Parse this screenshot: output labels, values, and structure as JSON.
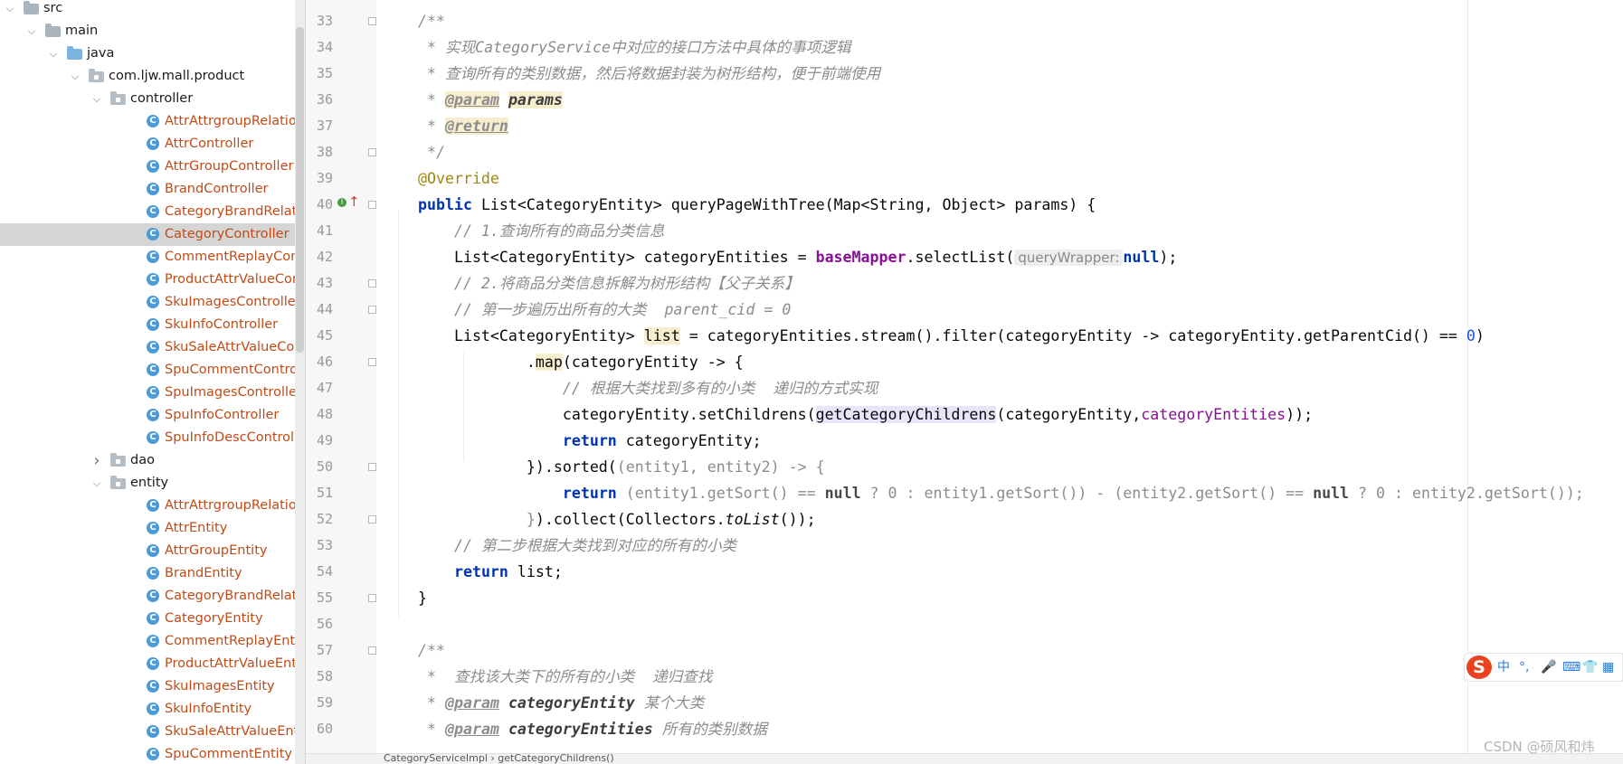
{
  "tree": {
    "nodes": [
      {
        "label": "src",
        "kind": "folder",
        "depth": 0,
        "expanded": true
      },
      {
        "label": "main",
        "kind": "folder",
        "depth": 1,
        "expanded": true
      },
      {
        "label": "java",
        "kind": "folder-blue",
        "depth": 2,
        "expanded": true
      },
      {
        "label": "com.ljw.mall.product",
        "kind": "package",
        "depth": 3,
        "expanded": true
      },
      {
        "label": "controller",
        "kind": "package",
        "depth": 4,
        "expanded": true
      },
      {
        "label": "AttrAttrgroupRelationCo",
        "kind": "class",
        "depth": 5
      },
      {
        "label": "AttrController",
        "kind": "class",
        "depth": 5
      },
      {
        "label": "AttrGroupController",
        "kind": "class",
        "depth": 5
      },
      {
        "label": "BrandController",
        "kind": "class",
        "depth": 5
      },
      {
        "label": "CategoryBrandRelationC",
        "kind": "class",
        "depth": 5
      },
      {
        "label": "CategoryController",
        "kind": "class",
        "depth": 5,
        "selected": true
      },
      {
        "label": "CommentReplayControl",
        "kind": "class",
        "depth": 5
      },
      {
        "label": "ProductAttrValueContro",
        "kind": "class",
        "depth": 5
      },
      {
        "label": "SkuImagesController",
        "kind": "class",
        "depth": 5
      },
      {
        "label": "SkuInfoController",
        "kind": "class",
        "depth": 5
      },
      {
        "label": "SkuSaleAttrValueContro",
        "kind": "class",
        "depth": 5
      },
      {
        "label": "SpuCommentController",
        "kind": "class",
        "depth": 5
      },
      {
        "label": "SpuImagesController",
        "kind": "class",
        "depth": 5
      },
      {
        "label": "SpuInfoController",
        "kind": "class",
        "depth": 5
      },
      {
        "label": "SpuInfoDescController",
        "kind": "class",
        "depth": 5
      },
      {
        "label": "dao",
        "kind": "package",
        "depth": 4,
        "expanded": false
      },
      {
        "label": "entity",
        "kind": "package",
        "depth": 4,
        "expanded": true
      },
      {
        "label": "AttrAttrgroupRelationEn",
        "kind": "class",
        "depth": 5
      },
      {
        "label": "AttrEntity",
        "kind": "class",
        "depth": 5
      },
      {
        "label": "AttrGroupEntity",
        "kind": "class",
        "depth": 5
      },
      {
        "label": "BrandEntity",
        "kind": "class",
        "depth": 5
      },
      {
        "label": "CategoryBrandRelationE",
        "kind": "class",
        "depth": 5
      },
      {
        "label": "CategoryEntity",
        "kind": "class",
        "depth": 5
      },
      {
        "label": "CommentReplayEntity",
        "kind": "class",
        "depth": 5
      },
      {
        "label": "ProductAttrValueEntity",
        "kind": "class",
        "depth": 5
      },
      {
        "label": "SkuImagesEntity",
        "kind": "class",
        "depth": 5
      },
      {
        "label": "SkuInfoEntity",
        "kind": "class",
        "depth": 5
      },
      {
        "label": "SkuSaleAttrValueEntity",
        "kind": "class",
        "depth": 5
      },
      {
        "label": "SpuCommentEntity",
        "kind": "class",
        "depth": 5
      }
    ]
  },
  "editor": {
    "line_numbers": [
      "33",
      "34",
      "35",
      "36",
      "37",
      "38",
      "39",
      "40",
      "41",
      "42",
      "43",
      "44",
      "45",
      "46",
      "47",
      "48",
      "49",
      "50",
      "51",
      "52",
      "53",
      "54",
      "55",
      "56",
      "57",
      "58",
      "59",
      "60"
    ],
    "code": {
      "l33": "/**",
      "l34": " * 实现CategoryService中对应的接口方法中具体的事项逻辑",
      "l35": " * 查询所有的类别数据，然后将数据封装为树形结构，便于前端使用",
      "l36_star": " * ",
      "l36_tag": "@param",
      "l36_name": "params",
      "l37_star": " * ",
      "l37_tag": "@return",
      "l38": " */",
      "l39": "@Override",
      "l40_kw": "public",
      "l40_rest": " List<CategoryEntity> queryPageWithTree(Map<String, Object> params) {",
      "l41": "    // 1.查询所有的商品分类信息",
      "l42_a": "    List<CategoryEntity> categoryEntities = ",
      "l42_field": "baseMapper",
      "l42_b": ".selectList(",
      "l42_hint": "queryWrapper:",
      "l42_null": "null",
      "l42_c": ");",
      "l43": "    // 2.将商品分类信息拆解为树形结构【父子关系】",
      "l44": "    // 第一步遍历出所有的大类  parent_cid = 0",
      "l45_a": "    List<CategoryEntity> ",
      "l45_var": "list",
      "l45_b": " = categoryEntities.stream().filter(categoryEntity -> categoryEntity.getParentCid() == ",
      "l45_num": "0",
      "l45_c": ")",
      "l46_a": "            .",
      "l46_map": "map",
      "l46_b": "(categoryEntity -> {",
      "l47": "                // 根据大类找到多有的小类  递归的方式实现",
      "l48_a": "                categoryEntity.setChildrens(",
      "l48_call": "getCategoryChildrens",
      "l48_b": "(categoryEntity,",
      "l48_field": "categoryEntities",
      "l48_c": "));",
      "l49_ret": "return",
      "l49_rest": " categoryEntity;",
      "l50_a": "            }).sorted(",
      "l50_b": "(entity1, entity2) -> {",
      "l51_ret": "return",
      "l51_a": " (entity1.getSort() == ",
      "l51_null1": "null",
      "l51_b": " ? 0 : entity1.getSort()) - (entity2.getSort() == ",
      "l51_null2": "null",
      "l51_c": " ? 0 : entity2.getSort());",
      "l52_a": "            }",
      "l52_b": ").collect(Collectors.",
      "l52_it": "toList",
      "l52_c": "());",
      "l53": "    // 第二步根据大类找到对应的所有的小类",
      "l54_ret": "return",
      "l54_rest": " list;",
      "l55": "}",
      "l57": "/**",
      "l58": " *  查找该大类下的所有的小类  递归查找",
      "l59_star": " * ",
      "l59_tag": "@param",
      "l59_name": "categoryEntity",
      "l59_desc": " 某个大类",
      "l60_star": " * ",
      "l60_tag": "@param",
      "l60_name": "categoryEntities",
      "l60_desc": " 所有的类别数据"
    },
    "breadcrumb": "CategoryServiceImpl  ›  getCategoryChildrens()"
  },
  "ime": {
    "logo": "S",
    "items": [
      "中",
      "°,",
      "🎤",
      "⌨",
      "👕",
      "▦"
    ]
  },
  "watermark": "CSDN @硕风和炜",
  "colors": {
    "keyword": "#0033b3",
    "comment": "#8c8c8c",
    "annotation": "#9e880d",
    "field": "#871094",
    "number": "#1750eb",
    "class_label": "#c04b17"
  }
}
